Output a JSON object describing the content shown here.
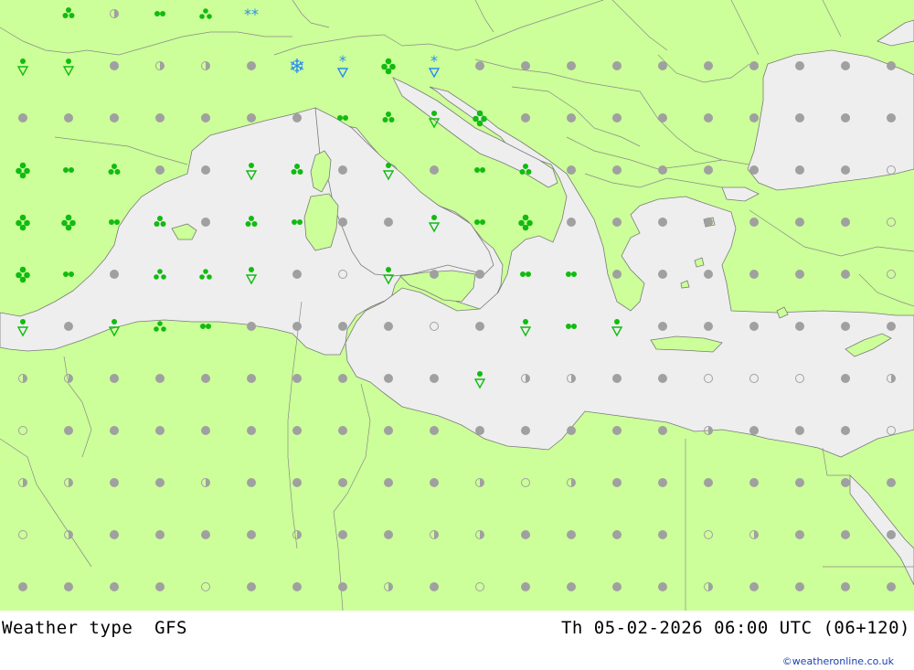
{
  "footer": {
    "title": "Weather type",
    "model": "GFS",
    "valid_time": "Th 05-02-2026 06:00 UTC (06+120)",
    "credit": "©weatheronline.co.uk"
  },
  "colors": {
    "land": "#ccff99",
    "sea": "#eeeeee",
    "precip": "#11bb11",
    "snow": "#2a8cf0",
    "cloud": "#a0a0a0"
  },
  "legend_symbols": [
    "dot-cloudy",
    "half-circle",
    "open-circle",
    "light-rain",
    "rain",
    "showers",
    "rain-showers",
    "snow-showers",
    "heavy-snow"
  ],
  "grid": {
    "rows": [
      "...S..H..R..T..P..........H..H..H....H",
      "W..W..D..H..H..D..Q..B..C..B..D..D..D..D..D..D..D..D..D..D",
      "D..D..D..D..D..D..D..R..S..W..C..D..D..D..D..D..D..D..D..D",
      "C..R..S..D..D..W..S..D..W..D..R..S..D..D..D..D..D..D..D..O",
      "C..C..R..S..D..S..R..D..D..W..R..C..D..D..D..D..D..D..D..O",
      "C..R..D..T..T..W..D..O..W..D..D..R..R..D..D..D..D..D..D..O",
      "W..D..W..T..R..D..D..D..D..O..D..W..R..W..D..D..D..D..D..D",
      "H..H..D..D..D..D..D..D..D..D..W..H..H..D..D..O..O..O..D..H",
      "O..D..D..D..D..D..D..D..D..D..D..D..D..D..D..H..D..D..D..O",
      "H..H..D..D..H..D..D..D..D..D..H..O..H..D..D..D..D..D..D..D",
      "O..H..D..D..D..D..H..D..D..H..H..D..D..D..D..O..H..D..D..D",
      "D..D..D..D..O..D..D..D..H..D..O..D..D..D..D..H..D..D..D..D"
    ]
  }
}
